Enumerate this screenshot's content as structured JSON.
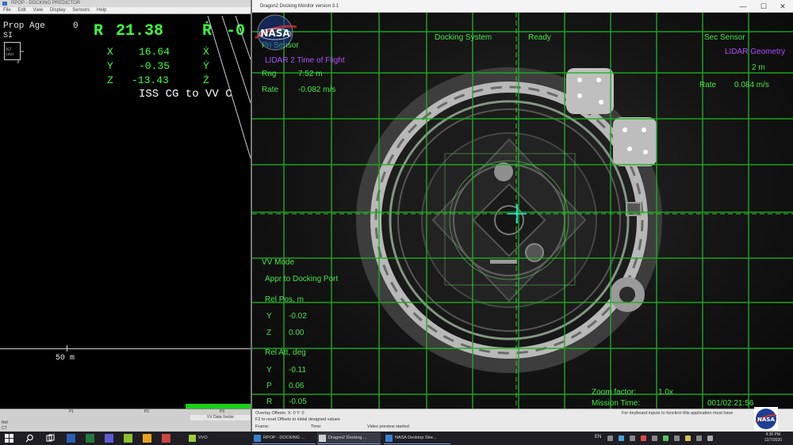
{
  "left_window": {
    "title": "RPOP - DOCKING PREDICTOR",
    "menu": [
      "File",
      "Edit",
      "View",
      "Display",
      "Sensors",
      "Help"
    ],
    "prop_age_label": "Prop Age",
    "prop_age_value": "0",
    "si_label": "SI",
    "range_label": "R",
    "range_value": "21.38",
    "range_rate_label": "Ṙ",
    "range_rate_value": "-0",
    "x_label": "X",
    "x_value": "16.64",
    "xdot_label": "Ẋ",
    "y_label": "Y",
    "y_value": "-0.35",
    "ydot_label": "Ẏ",
    "z_label": "Z",
    "z_value": "-13.43",
    "zdot_label": "Ż",
    "frame_label": "ISS CG to VV C",
    "scale_label": "50 m",
    "bottom_labels": [
      "P1",
      "P2",
      "P3"
    ],
    "bottom_right_label": "VV Data Vector",
    "side_labels": [
      "Ref",
      "CT"
    ]
  },
  "right_window": {
    "title": "Dragon2 Docking Monitor version 3.1",
    "controls": {
      "minimize": "—",
      "maximize": "☐",
      "close": "✕"
    },
    "overlay": {
      "pri_sensor_label": "Pri Sensor",
      "pri_sensor_type": "LIDAR 2 Time of Flight",
      "rng_label": "Rng",
      "rng_value": "7.52 m",
      "rate_label": "Rate",
      "rate_value": "-0.082 m/s",
      "docking_system_label": "Docking System",
      "docking_system_status": "Ready",
      "sec_sensor_label": "Sec Sensor",
      "sec_sensor_type": "LIDAR Geometry",
      "sec_rng_value": "2 m",
      "sec_rate_label": "Rate",
      "sec_rate_value": "0.084 m/s",
      "vv_mode_label": "VV Mode",
      "vv_mode_value": "Appr to Docking Port",
      "rel_pos_label": "Rel Pos, m",
      "rel_pos_y_label": "Y",
      "rel_pos_y_value": "-0.02",
      "rel_pos_z_label": "Z",
      "rel_pos_z_value": "0.00",
      "rel_att_label": "Rel Att, deg",
      "rel_att_y_label": "Y",
      "rel_att_y_value": "-0.11",
      "rel_att_p_label": "P",
      "rel_att_p_value": "0.06",
      "rel_att_r_label": "R",
      "rel_att_r_value": "-0.05",
      "zoom_label": "Zoom factor:",
      "zoom_value": "1.0x",
      "mission_time_label": "Mission Time:",
      "mission_time_value": "001/02:21:56"
    },
    "status": {
      "overlay_offsets": "Overlay Offsets: X: 0   Y: 0",
      "reset_hint": "F2 to reset Offsets to initial designed values",
      "frame_label": "Frame:",
      "time_label": "Time:",
      "video_status": "Video preview started",
      "keyboard_hint": "For keyboard inputs to function this application must have"
    },
    "nasa_text": "NASA"
  },
  "taskbar": {
    "apps": [
      {
        "label": "VVO",
        "color": "#9ccc3a"
      },
      {
        "label": "RPOP - DOCKING ...",
        "color": "#3a7fd0"
      },
      {
        "label": "Dragon2 Docking ...",
        "color": "#d0d0d0"
      },
      {
        "label": "NASA Desktop Stre...",
        "color": "#3a7fd0"
      }
    ],
    "lang": "EN",
    "clock_time": "4:35 PM",
    "clock_date": "12/7/2020"
  },
  "corner_logo_text": "NASA"
}
